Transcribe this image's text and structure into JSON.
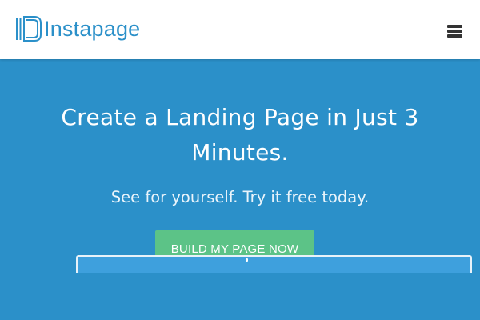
{
  "header": {
    "logo_text": "Instapage",
    "logo_icon": "instapage-logo-icon",
    "menu_icon": "hamburger-menu-icon"
  },
  "hero": {
    "title": "Create a Landing Page in Just 3 Minutes.",
    "subtitle": "See for yourself. Try it free today.",
    "cta_label": "BUILD MY PAGE NOW"
  },
  "colors": {
    "brand_blue": "#2b90c9",
    "cta_green": "#5cc387",
    "header_bg": "#ffffff",
    "menu_icon": "#333333"
  }
}
